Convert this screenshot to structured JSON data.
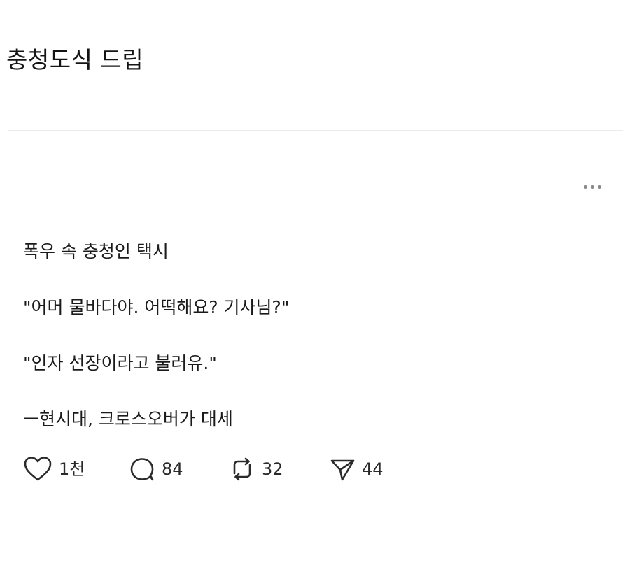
{
  "header": {
    "title": "충청도식 드립"
  },
  "post": {
    "more_icon": "more-horizontal-icon",
    "lines": [
      "폭우 속 충청인 택시",
      "\"어머 물바다야. 어떡해요? 기사님?\"",
      "\"인자 선장이라고 불러유.\"",
      "ㅡ현시대, 크로스오버가 대세"
    ]
  },
  "actions": {
    "like": {
      "icon": "heart-icon",
      "count": "1천"
    },
    "comment": {
      "icon": "comment-bubble-icon",
      "count": "84"
    },
    "repost": {
      "icon": "repost-icon",
      "count": "32"
    },
    "share": {
      "icon": "send-icon",
      "count": "44"
    }
  },
  "colors": {
    "text": "#1a1a1a",
    "divider": "#ececec",
    "icon": "#2a2a2a",
    "more_dots": "#8a8a8a"
  }
}
